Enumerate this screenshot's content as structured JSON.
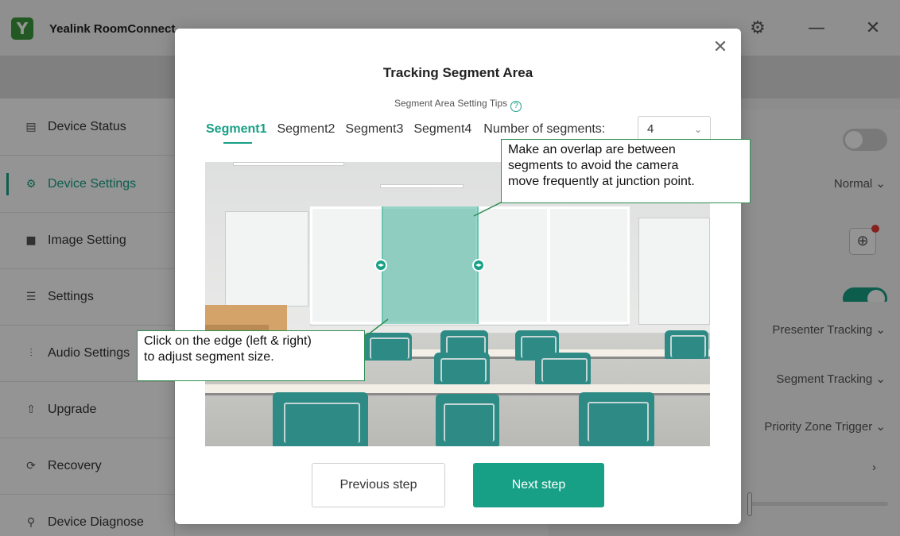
{
  "app": {
    "title": "Yealink RoomConnect",
    "logo_letter": "Y",
    "settings_icon": "gear-icon",
    "minimize_icon": "minimize-icon",
    "close_icon": "close-icon"
  },
  "sidebar": {
    "items": [
      {
        "label": "Device Status",
        "icon": "device-status-icon"
      },
      {
        "label": "Device Settings",
        "icon": "device-settings-icon",
        "active": true
      },
      {
        "label": "Image Setting",
        "icon": "camera-icon"
      },
      {
        "label": "Settings",
        "icon": "sliders-icon"
      },
      {
        "label": "Audio Settings",
        "icon": "audio-wave-icon"
      },
      {
        "label": "Upgrade",
        "icon": "upgrade-icon"
      },
      {
        "label": "Recovery",
        "icon": "recovery-icon"
      },
      {
        "label": "Device Diagnose",
        "icon": "diagnose-icon"
      }
    ]
  },
  "right_panel": {
    "row_normal": "Normal",
    "row_presenter": "Presenter Tracking",
    "row_segment": "Segment Tracking",
    "row_priority": "Priority Zone Trigger",
    "toggle1_on": false,
    "toggle2_on": true
  },
  "modal": {
    "title": "Tracking Segment Area",
    "tips": "Segment Area Setting Tips",
    "tabs": [
      "Segment1",
      "Segment2",
      "Segment3",
      "Segment4"
    ],
    "active_tab": "Segment1",
    "segments_label": "Number of segments:",
    "segments_value": "4",
    "prev_button": "Previous step",
    "next_button": "Next step",
    "accent_color": "#17a086"
  },
  "callouts": {
    "overlap_line1": "Make an overlap are between",
    "overlap_line2": "segments to avoid the camera",
    "overlap_line3": "move frequently at junction point.",
    "edge_line1": "Click on the edge (left & right)",
    "edge_line2": "to adjust segment size."
  }
}
